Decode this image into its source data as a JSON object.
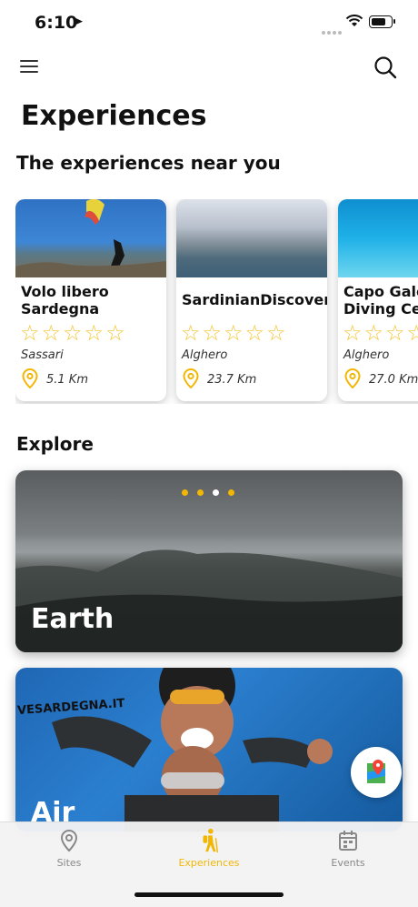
{
  "status": {
    "time": "6:10"
  },
  "header": {
    "title": "Experiences",
    "menu_icon": "hamburger-icon",
    "search_icon": "search-icon"
  },
  "near": {
    "title": "The experiences near you",
    "cards": [
      {
        "name": "Volo libero\nSardegna",
        "rating": "☆☆☆☆☆",
        "city": "Sassari",
        "distance": "5.1 Km"
      },
      {
        "name": "SardinianDiscovery",
        "rating": "☆☆☆☆☆",
        "city": "Alghero",
        "distance": "23.7 Km"
      },
      {
        "name": "Capo Galera\nDiving Center",
        "rating": "☆☆☆☆☆",
        "city": "Alghero",
        "distance": "27.0 Km"
      }
    ]
  },
  "explore": {
    "title": "Explore",
    "cards": [
      {
        "label": "Earth"
      },
      {
        "label": "Air",
        "watermark": "VESARDEGNA.IT"
      }
    ],
    "pager_active_index": 2
  },
  "tabs": [
    {
      "label": "Sites",
      "icon": "location-pin-icon"
    },
    {
      "label": "Experiences",
      "icon": "hiker-icon",
      "active": true
    },
    {
      "label": "Events",
      "icon": "calendar-icon"
    }
  ],
  "colors": {
    "accent": "#f2b705",
    "star": "#f4c430"
  }
}
